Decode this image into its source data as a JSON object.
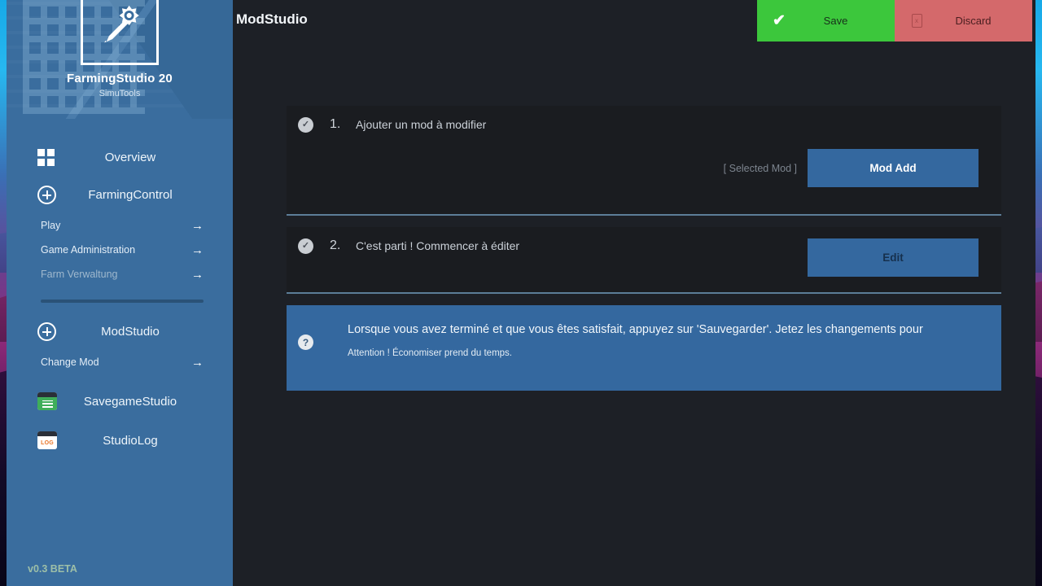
{
  "sidebar": {
    "logo_icon": "gear-pencil-icon",
    "app_title": "FarmingStudio 20",
    "app_subtitle": "SimuTools",
    "nav_main": [
      {
        "icon": "grid-icon",
        "label": "Overview"
      },
      {
        "icon": "plus-circle-icon",
        "label": "FarmingControl"
      }
    ],
    "nav_sub": [
      {
        "label": "Play",
        "arrow": "→",
        "dim": false
      },
      {
        "label": "Game Administration",
        "arrow": "→",
        "dim": false
      },
      {
        "label": "Farm Verwaltung",
        "arrow": "→",
        "dim": true
      }
    ],
    "modstudio": {
      "icon": "plus-circle-icon",
      "label": "ModStudio"
    },
    "change_mod": {
      "label": "Change Mod",
      "arrow": "→"
    },
    "apps": [
      {
        "icon": "savegame-window-icon",
        "label": "SavegameStudio"
      },
      {
        "icon": "log-window-icon",
        "label": "StudioLog"
      }
    ],
    "version": "v0.3 BETA"
  },
  "topbar": {
    "title": "ModStudio",
    "save": {
      "label": "Save",
      "icon": "check-icon",
      "color": "#3cc73c"
    },
    "discard": {
      "label": "Discard",
      "icon": "discard-doc-icon",
      "color": "#d4696b"
    }
  },
  "steps": [
    {
      "badge": "✓",
      "number": "1.",
      "text": "Ajouter un mod à modifier",
      "selected_mod": "[ Selected Mod ]",
      "button": "Mod Add"
    },
    {
      "badge": "✓",
      "number": "2.",
      "text": "C'est parti ! Commencer à éditer",
      "button": "Edit"
    }
  ],
  "info": {
    "badge": "?",
    "line1": "Lorsque vous avez terminé et que vous êtes satisfait, appuyez sur 'Sauvegarder'. Jetez les changements pour",
    "line2": "Attention ! Économiser prend du temps."
  }
}
